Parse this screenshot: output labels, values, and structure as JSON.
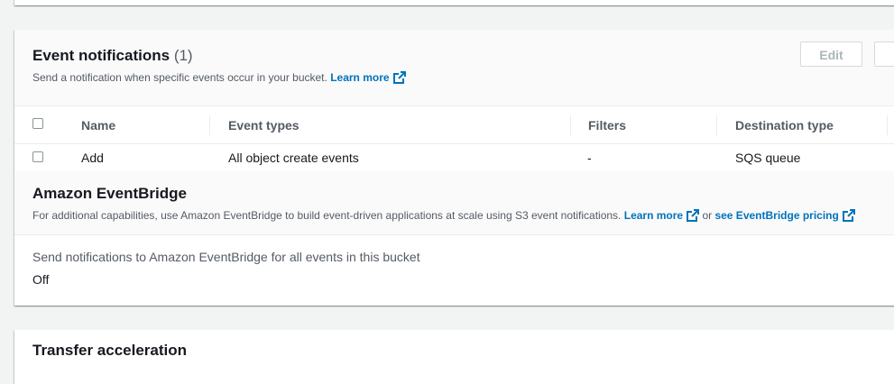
{
  "event_notifications": {
    "title": "Event notifications",
    "count": "(1)",
    "description": "Send a notification when specific events occur in your bucket.",
    "learn_more": "Learn more",
    "edit_label": "Edit",
    "columns": [
      "Name",
      "Event types",
      "Filters",
      "Destination type"
    ],
    "rows": [
      {
        "name": "Add",
        "event_types": "All object create events",
        "filters": "-",
        "destination_type": "SQS queue"
      }
    ]
  },
  "eventbridge": {
    "title": "Amazon EventBridge",
    "description": "For additional capabilities, use Amazon EventBridge to build event-driven applications at scale using S3 event notifications.",
    "learn_more": "Learn more",
    "or_text": "or",
    "pricing_link": "see EventBridge pricing",
    "setting_label": "Send notifications to Amazon EventBridge for all events in this bucket",
    "setting_value": "Off"
  },
  "transfer_acceleration": {
    "title": "Transfer acceleration"
  },
  "colors": {
    "link": "#0073bb",
    "page_bg": "#f2f3f3"
  }
}
